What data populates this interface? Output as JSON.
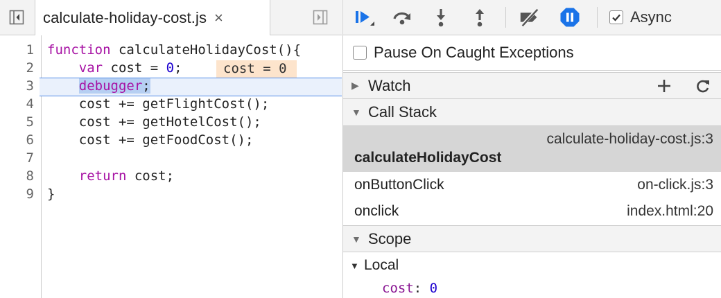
{
  "source": {
    "tab": {
      "label": "calculate-holiday-cost.js",
      "close_glyph": "×"
    },
    "line_numbers": [
      "1",
      "2",
      "3",
      "4",
      "5",
      "6",
      "7",
      "8",
      "9"
    ],
    "code": {
      "l1_kw": "function",
      "l1_rest": " calculateHolidayCost(){",
      "l2_indent": "    ",
      "l2_kw": "var",
      "l2_mid": " cost = ",
      "l2_num": "0",
      "l2_end": ";",
      "l2_inline": "cost = 0",
      "l3_indent": "    ",
      "l3_kw": "debugger",
      "l3_end": ";",
      "l4": "    cost += getFlightCost();",
      "l5": "    cost += getHotelCost();",
      "l6": "    cost += getFoodCost();",
      "l7": "",
      "l8_indent": "    ",
      "l8_kw": "return",
      "l8_rest": " cost;",
      "l9": "}"
    },
    "colors": {
      "keyword": "#a713a4",
      "number": "#1c00cf",
      "exec_line_border": "#4d88e6",
      "inline_value_bg": "#fde4cc"
    }
  },
  "toolbar": {
    "icons": [
      "resume-icon",
      "step-over-icon",
      "step-into-icon",
      "step-out-icon",
      "deactivate-breakpoints-icon",
      "pause-on-exceptions-icon"
    ],
    "async_label": "Async",
    "async_checked": true,
    "accent": "#1a73e8"
  },
  "pause_on_caught": {
    "label": "Pause On Caught Exceptions",
    "checked": false
  },
  "watch": {
    "title": "Watch",
    "expanded": false,
    "add_icon": "plus-icon",
    "refresh_icon": "refresh-icon"
  },
  "call_stack": {
    "title": "Call Stack",
    "expanded": true,
    "frames": [
      {
        "fn": "calculateHolidayCost",
        "loc": "calculate-holiday-cost.js:3",
        "selected": true
      },
      {
        "fn": "onButtonClick",
        "loc": "on-click.js:3",
        "selected": false
      },
      {
        "fn": "onclick",
        "loc": "index.html:20",
        "selected": false
      }
    ]
  },
  "scope": {
    "title": "Scope",
    "expanded": true,
    "local": {
      "label": "Local",
      "expanded": true,
      "vars": [
        {
          "name": "cost",
          "value": "0"
        }
      ]
    }
  }
}
